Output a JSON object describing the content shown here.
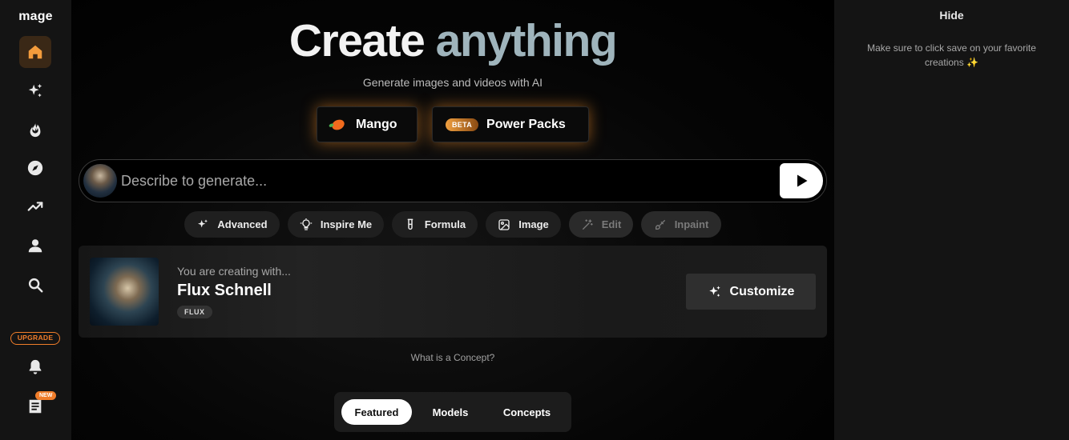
{
  "sidebar": {
    "logo": "mage",
    "items": [
      {
        "name": "home",
        "icon": "home-icon"
      },
      {
        "name": "create",
        "icon": "sparkles-icon"
      },
      {
        "name": "hot",
        "icon": "flame-icon"
      },
      {
        "name": "explore",
        "icon": "compass-icon"
      },
      {
        "name": "trending",
        "icon": "trending-up-icon"
      },
      {
        "name": "profile",
        "icon": "user-icon"
      },
      {
        "name": "search",
        "icon": "search-icon"
      },
      {
        "name": "notifications",
        "icon": "bell-icon"
      },
      {
        "name": "news",
        "icon": "newspaper-icon"
      }
    ],
    "upgrade_label": "UPGRADE",
    "new_badge": "NEW",
    "accent_color": "#f07d2a"
  },
  "hero": {
    "title_part1": "Create",
    "title_part2": "anything",
    "subtitle": "Generate images and videos with AI"
  },
  "featured_buttons": {
    "mango_label": "Mango",
    "beta_badge": "BETA",
    "power_packs_label": "Power Packs"
  },
  "prompt": {
    "placeholder": "Describe to generate..."
  },
  "tools": [
    {
      "label": "Advanced",
      "icon": "sparkles-icon",
      "enabled": true
    },
    {
      "label": "Inspire Me",
      "icon": "lightbulb-icon",
      "enabled": true
    },
    {
      "label": "Formula",
      "icon": "test-tube-icon",
      "enabled": true
    },
    {
      "label": "Image",
      "icon": "image-icon",
      "enabled": true
    },
    {
      "label": "Edit",
      "icon": "magic-wand-icon",
      "enabled": false
    },
    {
      "label": "Inpaint",
      "icon": "brush-icon",
      "enabled": false
    }
  ],
  "concept": {
    "subtitle": "You are creating with...",
    "name": "Flux Schnell",
    "tag": "FLUX",
    "customize_label": "Customize",
    "link": "What is a Concept?"
  },
  "tabs": [
    {
      "label": "Featured",
      "active": true
    },
    {
      "label": "Models",
      "active": false
    },
    {
      "label": "Concepts",
      "active": false
    }
  ],
  "right_panel": {
    "hide_label": "Hide",
    "note": "Make sure to click save on your favorite creations ✨"
  }
}
